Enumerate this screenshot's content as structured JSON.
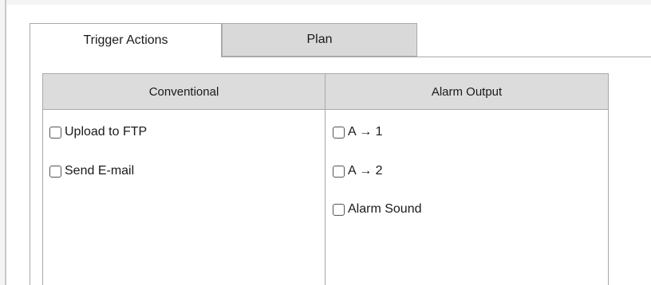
{
  "tabs": [
    {
      "label": "Trigger Actions",
      "active": true
    },
    {
      "label": "Plan",
      "active": false
    }
  ],
  "columns": {
    "conventional": {
      "header": "Conventional",
      "options": [
        {
          "label": "Upload to FTP",
          "checked": false
        },
        {
          "label": "Send E-mail",
          "checked": false
        }
      ]
    },
    "alarm_output": {
      "header": "Alarm Output",
      "options": [
        {
          "label": "A → 1",
          "checked": false
        },
        {
          "label": "A → 2",
          "checked": false
        },
        {
          "label": "Alarm Sound",
          "checked": false
        }
      ]
    }
  }
}
